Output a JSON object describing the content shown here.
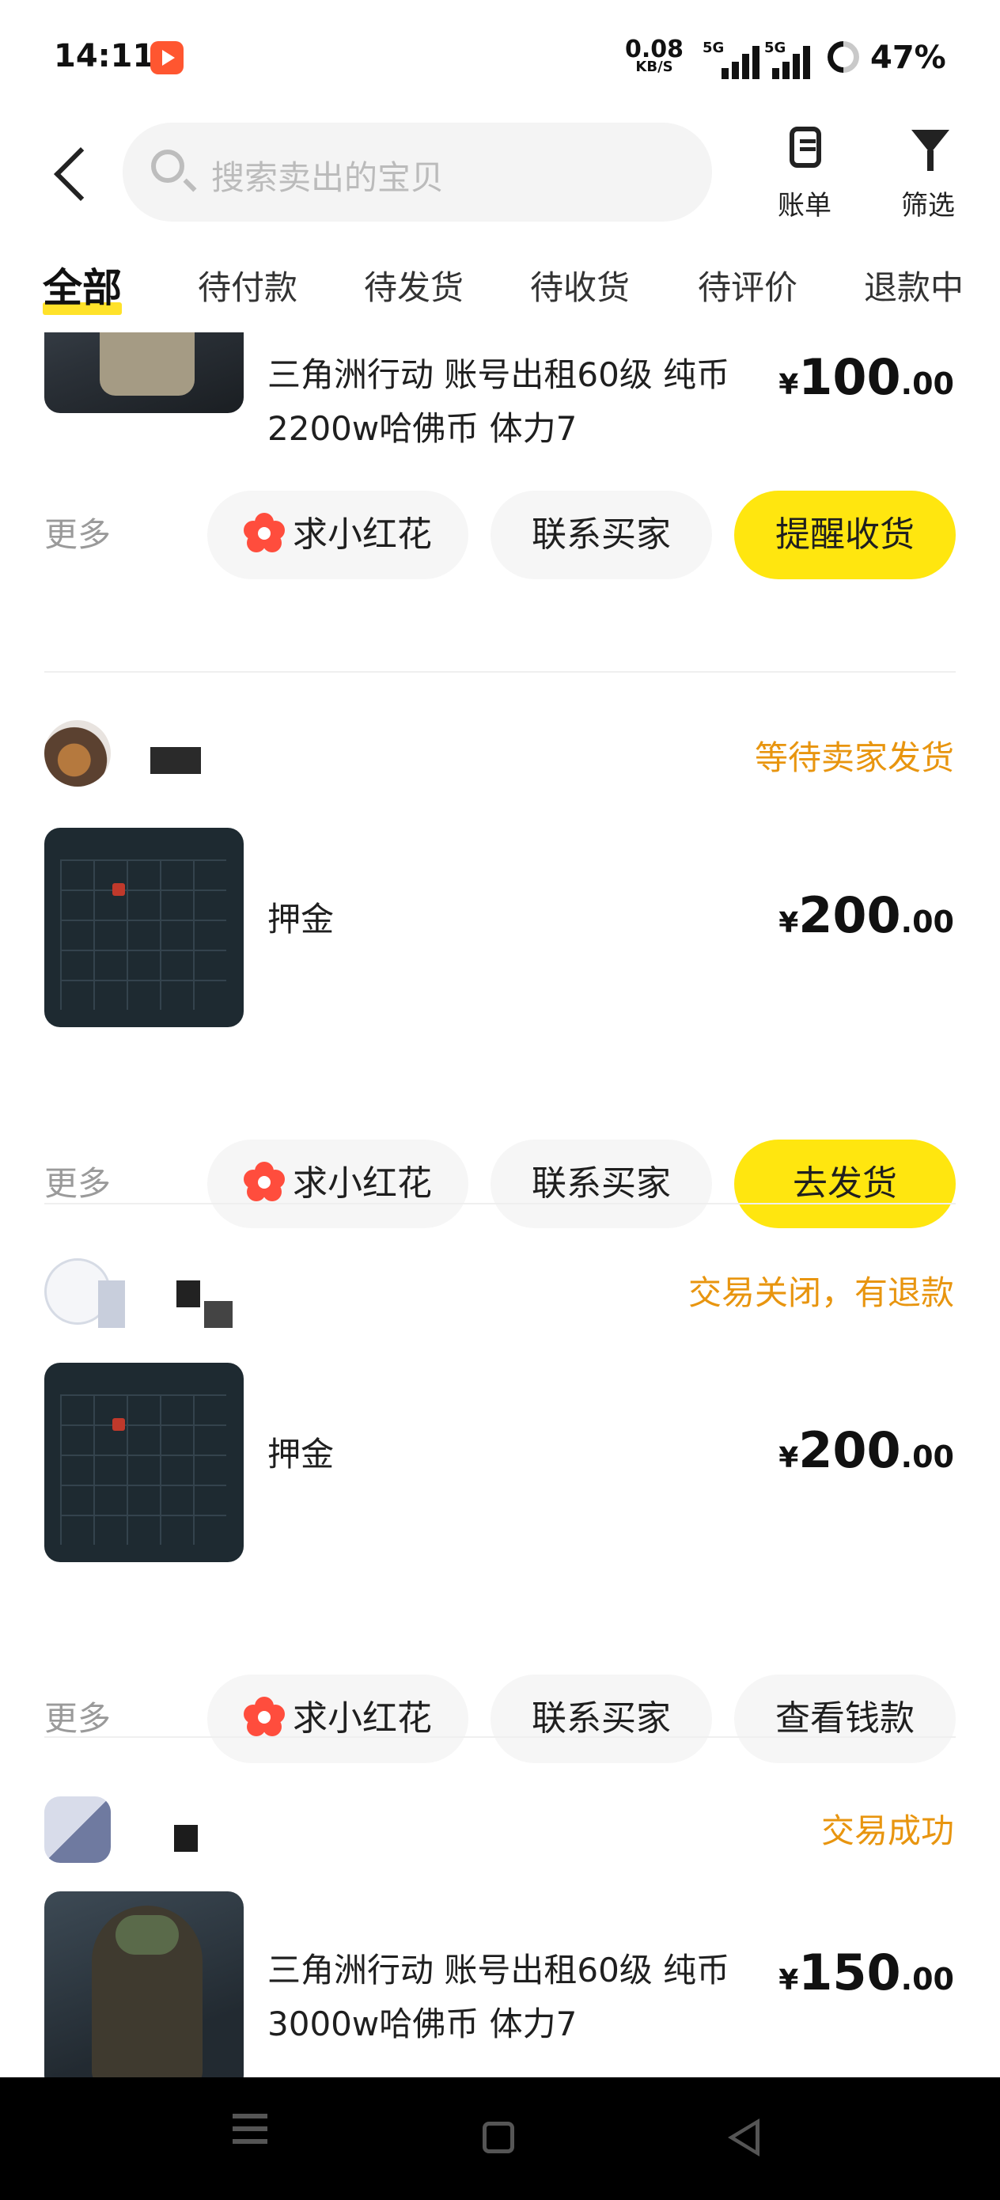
{
  "status_bar": {
    "time": "14:11",
    "speed_value": "0.08",
    "speed_unit": "KB/S",
    "sim1": "5G",
    "sim2": "5G",
    "battery": "47%"
  },
  "header": {
    "search_placeholder": "搜索卖出的宝贝",
    "bill_label": "账单",
    "filter_label": "筛选"
  },
  "tabs": [
    "全部",
    "待付款",
    "待发货",
    "待收货",
    "待评价",
    "退款中"
  ],
  "orders": [
    {
      "status": "",
      "title": "三角洲行动 账号出租60级 纯币2200w哈佛币 体力7",
      "price_currency": "¥",
      "price_int": "100",
      "price_dec": ".00",
      "more": "更多",
      "btn_flower": "求小红花",
      "btn_contact": "联系买家",
      "btn_primary": "提醒收货"
    },
    {
      "status": "等待卖家发货",
      "title": "押金",
      "price_currency": "¥",
      "price_int": "200",
      "price_dec": ".00",
      "more": "更多",
      "btn_flower": "求小红花",
      "btn_contact": "联系买家",
      "btn_primary": "去发货"
    },
    {
      "status": "交易关闭，有退款",
      "title": "押金",
      "price_currency": "¥",
      "price_int": "200",
      "price_dec": ".00",
      "more": "更多",
      "btn_flower": "求小红花",
      "btn_contact": "联系买家",
      "btn_primary": "查看钱款"
    },
    {
      "status": "交易成功",
      "title": "三角洲行动 账号出租60级 纯币3000w哈佛币 体力7",
      "price_currency": "¥",
      "price_int": "150",
      "price_dec": ".00"
    }
  ],
  "colors": {
    "accent_yellow": "#ffe60f",
    "status_orange": "#e8950f"
  }
}
